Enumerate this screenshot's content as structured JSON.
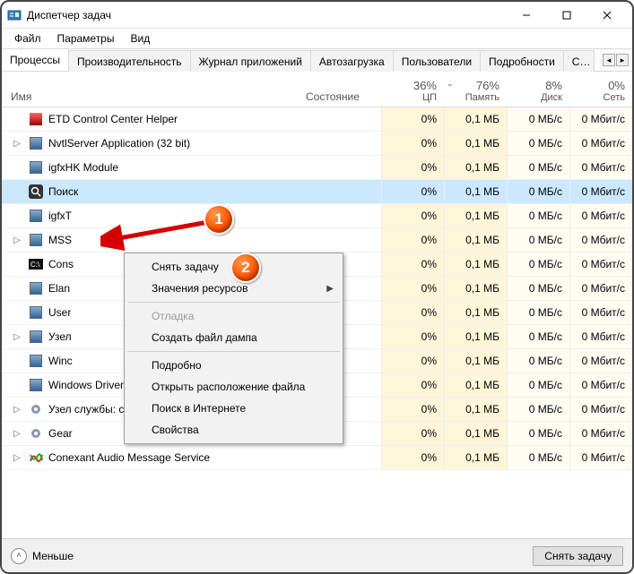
{
  "window": {
    "title": "Диспетчер задач"
  },
  "menubar": {
    "file": "Файл",
    "options": "Параметры",
    "view": "Вид"
  },
  "tabs": {
    "items": [
      {
        "label": "Процессы"
      },
      {
        "label": "Производительность"
      },
      {
        "label": "Журнал приложений"
      },
      {
        "label": "Автозагрузка"
      },
      {
        "label": "Пользователи"
      },
      {
        "label": "Подробности"
      },
      {
        "label": "С…"
      }
    ],
    "active_index": 0
  },
  "columns": {
    "name": "Имя",
    "state": "Состояние",
    "cpu": {
      "percent": "36%",
      "label": "ЦП"
    },
    "mem": {
      "percent": "76%",
      "label": "Память"
    },
    "disk": {
      "percent": "8%",
      "label": "Диск"
    },
    "net": {
      "percent": "0%",
      "label": "Сеть"
    }
  },
  "rows": [
    {
      "expand": false,
      "name": "ETD Control Center Helper",
      "icon": "red-shield-icon",
      "cpu": "0%",
      "mem": "0,1 МБ",
      "disk": "0 МБ/с",
      "net": "0 Мбит/с"
    },
    {
      "expand": true,
      "name": "NvtlServer Application (32 bit)",
      "icon": "blue-app-icon",
      "cpu": "0%",
      "mem": "0,1 МБ",
      "disk": "0 МБ/с",
      "net": "0 Мбит/с"
    },
    {
      "expand": false,
      "name": "igfxHK Module",
      "icon": "blue-app-icon",
      "cpu": "0%",
      "mem": "0,1 МБ",
      "disk": "0 МБ/с",
      "net": "0 Мбит/с"
    },
    {
      "expand": false,
      "name": "Поиск",
      "icon": "search-icon",
      "selected": true,
      "cpu": "0%",
      "mem": "0,1 МБ",
      "disk": "0 МБ/с",
      "net": "0 Мбит/с"
    },
    {
      "expand": false,
      "name": "igfxT",
      "icon": "blue-app-icon",
      "cpu": "0%",
      "mem": "0,1 МБ",
      "disk": "0 МБ/с",
      "net": "0 Мбит/с"
    },
    {
      "expand": true,
      "name": "MSS",
      "icon": "blue-app-icon",
      "cpu": "0%",
      "mem": "0,1 МБ",
      "disk": "0 МБ/с",
      "net": "0 Мбит/с"
    },
    {
      "expand": false,
      "name": "Cons",
      "icon": "console-icon",
      "cpu": "0%",
      "mem": "0,1 МБ",
      "disk": "0 МБ/с",
      "net": "0 Мбит/с"
    },
    {
      "expand": false,
      "name": "Elan",
      "icon": "blue-app-icon",
      "cpu": "0%",
      "mem": "0,1 МБ",
      "disk": "0 МБ/с",
      "net": "0 Мбит/с"
    },
    {
      "expand": false,
      "name": "User",
      "icon": "blue-app-icon",
      "cpu": "0%",
      "mem": "0,1 МБ",
      "disk": "0 МБ/с",
      "net": "0 Мбит/с"
    },
    {
      "expand": true,
      "name": "Узел",
      "icon": "blue-app-icon",
      "cpu": "0%",
      "mem": "0,1 МБ",
      "disk": "0 МБ/с",
      "net": "0 Мбит/с"
    },
    {
      "expand": false,
      "name": "Winc",
      "icon": "blue-app-icon",
      "cpu": "0%",
      "mem": "0,1 МБ",
      "disk": "0 МБ/с",
      "net": "0 Мбит/с"
    },
    {
      "expand": false,
      "name": "Windows Driver Foundation (W…",
      "icon": "blue-app-icon",
      "cpu": "0%",
      "mem": "0,1 МБ",
      "disk": "0 МБ/с",
      "net": "0 Мбит/с"
    },
    {
      "expand": true,
      "name": "Узел службы: сетевая служба …",
      "icon": "gear-icon",
      "cpu": "0%",
      "mem": "0,1 МБ",
      "disk": "0 МБ/с",
      "net": "0 Мбит/с"
    },
    {
      "expand": true,
      "name": "Gear",
      "icon": "gear-icon",
      "cpu": "0%",
      "mem": "0,1 МБ",
      "disk": "0 МБ/с",
      "net": "0 Мбит/с"
    },
    {
      "expand": true,
      "name": "Conexant Audio Message Service",
      "icon": "conexant-icon",
      "cpu": "0%",
      "mem": "0,1 МБ",
      "disk": "0 МБ/с",
      "net": "0 Мбит/с"
    }
  ],
  "context_menu": {
    "items": [
      {
        "label": "Снять задачу",
        "highlight": true
      },
      {
        "label": "Значения ресурсов",
        "submenu": true
      },
      {
        "sep": true
      },
      {
        "label": "Отладка",
        "disabled": true
      },
      {
        "label": "Создать файл дампа"
      },
      {
        "sep": true
      },
      {
        "label": "Подробно"
      },
      {
        "label": "Открыть расположение файла"
      },
      {
        "label": "Поиск в Интернете"
      },
      {
        "label": "Свойства"
      }
    ]
  },
  "statusbar": {
    "fewer": "Меньше",
    "end_task": "Снять задачу"
  },
  "markers": {
    "one": "1",
    "two": "2"
  }
}
